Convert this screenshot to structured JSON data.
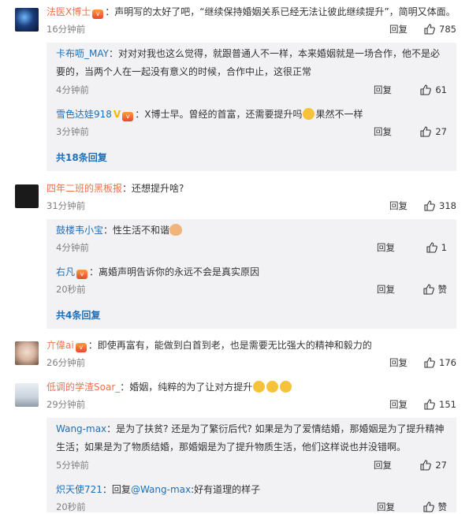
{
  "labels": {
    "reply": "回复",
    "separator": "："
  },
  "comments": [
    {
      "user": "法医X博士",
      "text": "声明写的太好了吧，“继续保持婚姻关系已经无法让彼此继续提升”，简明又体面。",
      "time": "16分钟前",
      "likes": "785",
      "replies": [
        {
          "user": "卡布呖_MAY",
          "text_line1": "对对对我也这么觉得，就跟普通人不一样，本来婚姻就是一场合作，他不是必",
          "text_line2": "要的，当两个人在一起没有意义的时候，合作中止，这很正常",
          "time": "4分钟前",
          "likes": "61"
        },
        {
          "user": "雪色达娃918",
          "text": "X博士早。曾经的首富，还需要提升吗",
          "text_after_emoji": "果然不一样",
          "time": "3分钟前",
          "likes": "27"
        }
      ],
      "more": "共18条回复"
    },
    {
      "user": "四年二班的黑板报",
      "text": "还想提升啥?",
      "time": "31分钟前",
      "likes": "318",
      "replies": [
        {
          "user": "鼓楼韦小宝",
          "text": "性生活不和谐",
          "time": "4分钟前",
          "likes": "1"
        },
        {
          "user": "右凡",
          "text": "离婚声明告诉你的永远不会是真实原因",
          "time": "20秒前",
          "likes": "赞"
        }
      ],
      "more": "共4条回复"
    },
    {
      "user": "亣偉ai",
      "text": "即使再富有，能做到白首到老，也是需要无比强大的精神和毅力的",
      "time": "26分钟前",
      "likes": "176"
    },
    {
      "user": "低调的学渣Soar_",
      "text": "婚姻，纯粹的为了让对方提升",
      "time": "29分钟前",
      "likes": "151",
      "replies": [
        {
          "user": "Wang-max",
          "text_line1": "是为了扶贫? 还是为了繁衍后代? 如果是为了爱情结婚，那婚姻是为了提升精神",
          "text_line2": "生活；如果是为了物质结婚，那婚姻是为了提升物质生活，他们这样说也并没错啊。",
          "time": "5分钟前",
          "likes": "27"
        },
        {
          "user": "炽天使721",
          "reply_prefix": "回复",
          "mention": "@Wang-max",
          "text": ":好有道理的样子",
          "time": "20秒前",
          "likes": "赞"
        }
      ]
    }
  ]
}
